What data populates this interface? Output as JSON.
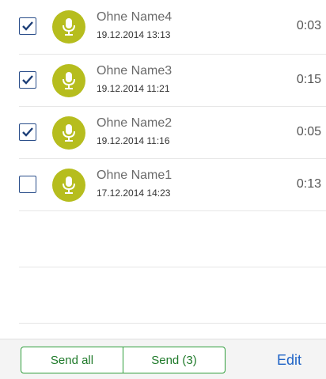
{
  "recordings": [
    {
      "name": "Ohne Name4",
      "date": "19.12.2014 13:13",
      "duration": "0:03",
      "checked": true
    },
    {
      "name": "Ohne Name3",
      "date": "19.12.2014 11:21",
      "duration": "0:15",
      "checked": true
    },
    {
      "name": "Ohne Name2",
      "date": "19.12.2014 11:16",
      "duration": "0:05",
      "checked": true
    },
    {
      "name": "Ohne Name1",
      "date": "17.12.2014 14:23",
      "duration": "0:13",
      "checked": false
    }
  ],
  "toolbar": {
    "send_all_label": "Send all",
    "send_label": "Send (3)",
    "edit_label": "Edit"
  },
  "colors": {
    "mic_accent": "#b6bd1e",
    "checkbox": "#2a4e8a",
    "button_green": "#2f9e3b",
    "edit_blue": "#1f63c6"
  }
}
